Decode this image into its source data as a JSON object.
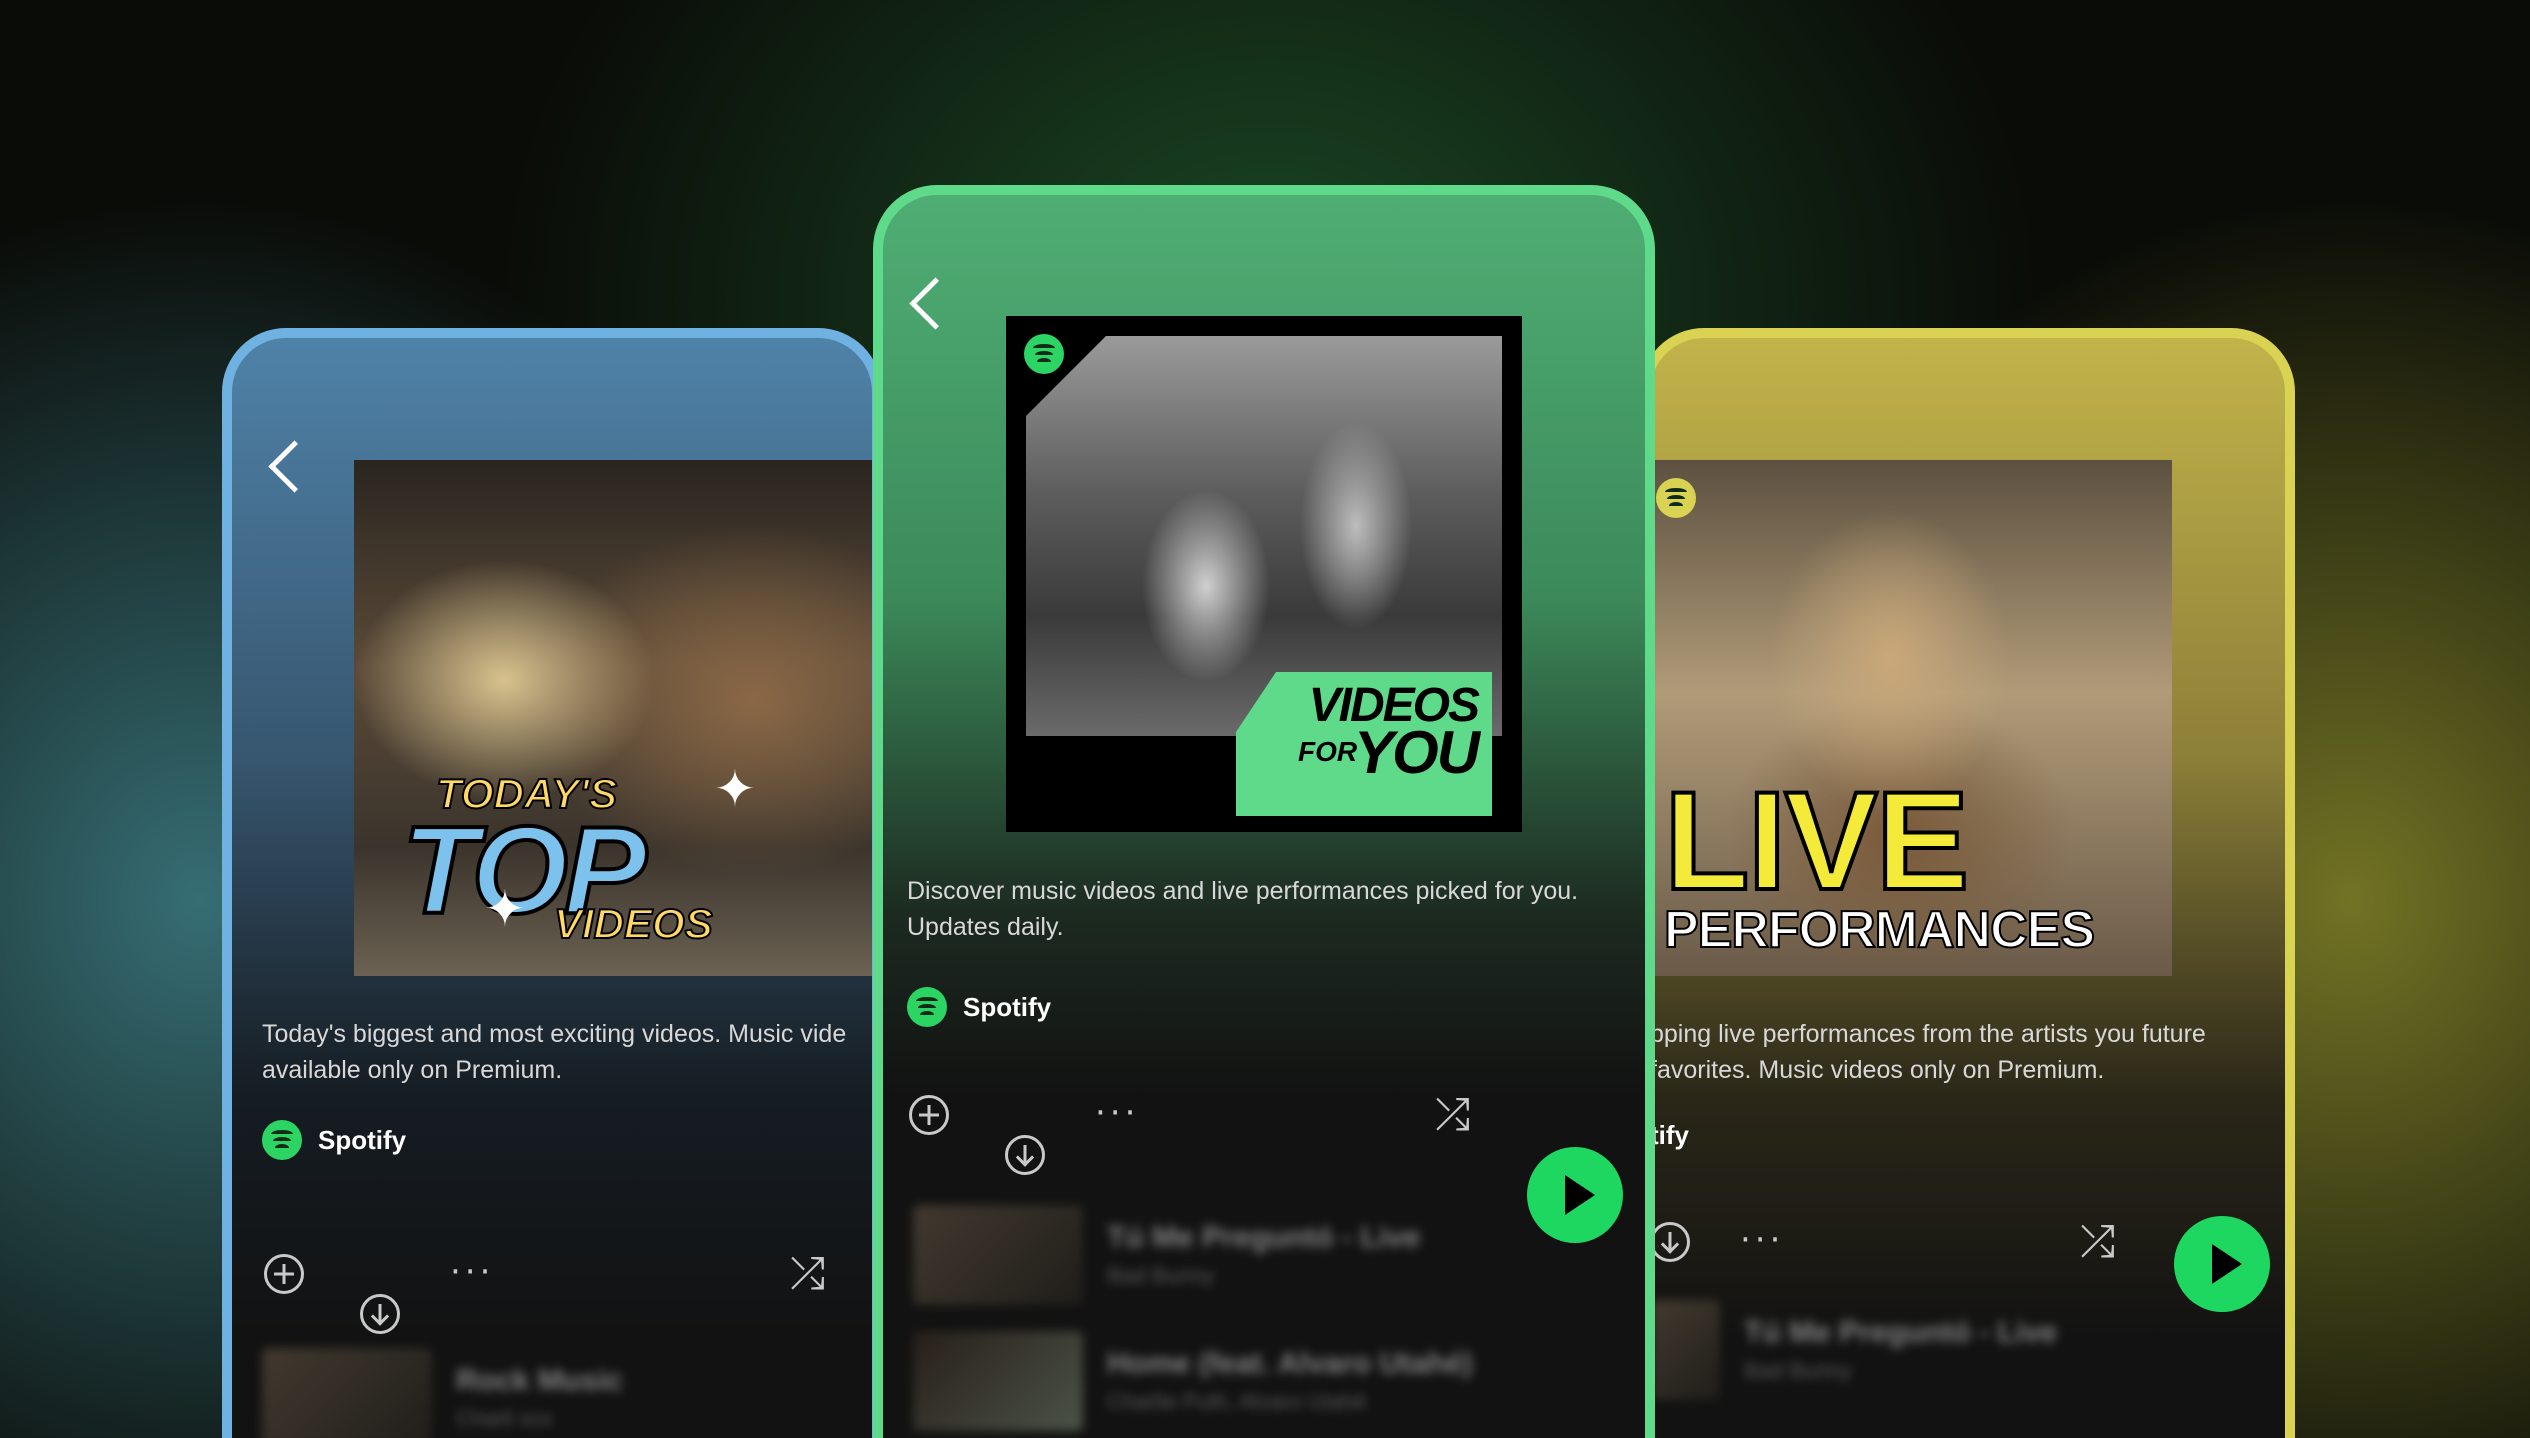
{
  "playlists": {
    "left": {
      "title": "TODAY'S TOP VIDEOS",
      "title_parts": {
        "top": "TODAY'S",
        "main": "TOP",
        "bottom": "VIDEOS"
      },
      "description": "Today's biggest and most exciting videos. Music vide available only on Premium.",
      "owner": "Spotify",
      "theme_color": "#6fb2e2",
      "track": {
        "title": "Rock Music",
        "artist": "Charli xcx"
      }
    },
    "center": {
      "title": "VIDEOS FOR YOU",
      "title_parts": {
        "top": "VIDEOS",
        "for": "FOR",
        "you": "YOU"
      },
      "description": "Discover music videos and live performances picked for you. Updates daily.",
      "owner": "Spotify",
      "theme_color": "#5fd98a",
      "tracks": [
        {
          "title": "Tú Me Preguntó - Live",
          "artist": "Bad Bunny"
        },
        {
          "title": "Home (feat. Alvaro Utahé)",
          "artist": "Charlie Puth, Alvaro Utahé"
        }
      ]
    },
    "right": {
      "title": "LIVE PERFORMANCES",
      "title_parts": {
        "main": "LIVE",
        "sub": "PERFORMANCES"
      },
      "description": "pping live performances from the artists you future favorites. Music videos only on Premium.",
      "owner": "tify",
      "theme_color": "#d9d252",
      "track": {
        "title": "Tú Me Preguntó - Live",
        "artist": "Bad Bunny"
      }
    }
  },
  "icons": {
    "back": "chevron-left-icon",
    "add": "plus-circle-icon",
    "download": "download-circle-icon",
    "more": "more-dots-icon",
    "shuffle": "shuffle-icon",
    "play": "play-icon",
    "brand": "spotify-logo-icon"
  },
  "glyphs": {
    "more": "···",
    "shuffle": "⤮"
  },
  "accent": "#1ed760"
}
